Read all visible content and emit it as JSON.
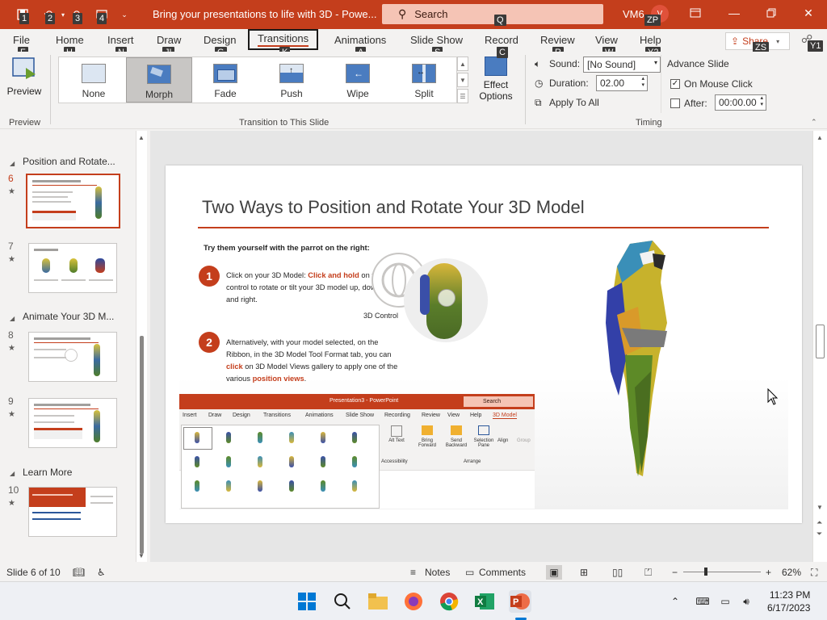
{
  "titlebar": {
    "doc_title": "Bring your presentations to life with 3D  -  Powe...",
    "search_label": "Search",
    "user_initials": "VM6",
    "avatar_text": "V",
    "keytips": [
      "1",
      "2",
      "3",
      "4",
      "Q",
      "ZP"
    ]
  },
  "tabs": [
    {
      "label": "File",
      "keytip": "F"
    },
    {
      "label": "Home",
      "keytip": "H"
    },
    {
      "label": "Insert",
      "keytip": "N"
    },
    {
      "label": "Draw",
      "keytip": "JI"
    },
    {
      "label": "Design",
      "keytip": "G"
    },
    {
      "label": "Transitions",
      "keytip": "K"
    },
    {
      "label": "Animations",
      "keytip": "A"
    },
    {
      "label": "Slide Show",
      "keytip": "S"
    },
    {
      "label": "Record",
      "keytip": "C"
    },
    {
      "label": "Review",
      "keytip": "R"
    },
    {
      "label": "View",
      "keytip": "W"
    },
    {
      "label": "Help",
      "keytip": "Y2"
    }
  ],
  "share": {
    "label": "Share",
    "keytip": "ZS",
    "extra_keytip": "Y1"
  },
  "ribbon": {
    "preview_label": "Preview",
    "preview_group": "Preview",
    "transitions": [
      "None",
      "Morph",
      "Fade",
      "Push",
      "Wipe",
      "Split"
    ],
    "selected_transition": "Morph",
    "effect_options_line1": "Effect",
    "effect_options_line2": "Options",
    "transition_group": "Transition to This Slide",
    "sound_label": "Sound:",
    "sound_value": "[No Sound]",
    "duration_label": "Duration:",
    "duration_value": "02.00",
    "apply_all_label": "Apply To All",
    "advance_slide_label": "Advance Slide",
    "on_mouse_click_label": "On Mouse Click",
    "on_mouse_click_checked": true,
    "after_label": "After:",
    "after_value": "00:00.00",
    "after_checked": false,
    "timing_group": "Timing"
  },
  "thumbnails": {
    "sections": [
      {
        "title": "Position and Rotate..."
      },
      {
        "title": "Animate Your 3D M..."
      },
      {
        "title": "Learn More"
      }
    ],
    "slides": [
      {
        "number": "6",
        "current": true
      },
      {
        "number": "7",
        "current": false
      },
      {
        "number": "8",
        "current": false
      },
      {
        "number": "9",
        "current": false
      },
      {
        "number": "10",
        "current": false
      }
    ]
  },
  "slide": {
    "title": "Two Ways to Position and Rotate Your 3D Model",
    "subtitle": "Try them yourself with the parrot on the right:",
    "step1_number": "1",
    "step1_a": "Click on your 3D Model: ",
    "step1_hl": "Click and hold",
    "step1_b": " on the 3D control to rotate or tilt your 3D model up, down, left, and right.",
    "step2_number": "2",
    "step2_a": "Alternatively, with your model selected, on the Ribbon, in the 3D Model Tool Format tab, you can ",
    "step2_hl1": "click",
    "step2_b": " on 3D Model Views gallery to apply one of the various ",
    "step2_hl2": "position views",
    "step2_c": ".",
    "control_label": "3D Control",
    "mini": {
      "title": "Presentation3  -  PowerPoint",
      "search": "Search",
      "tabs": [
        "Insert",
        "Draw",
        "Design",
        "Transitions",
        "Animations",
        "Slide Show",
        "Recording",
        "Review",
        "View",
        "Help",
        "3D Model"
      ],
      "alt_text": "Alt Text",
      "accessibility": "Accessibility",
      "bring_forward": "Bring Forward",
      "send_backward": "Send Backward",
      "selection_pane": "Selection Pane",
      "align": "Align",
      "group": "Group",
      "arrange": "Arrange"
    }
  },
  "statusbar": {
    "slide_info": "Slide 6 of 10",
    "notes_label": "Notes",
    "comments_label": "Comments",
    "zoom": "62%"
  },
  "taskbar": {
    "time": "11:23 PM",
    "date": "6/17/2023"
  },
  "colors": {
    "accent": "#c43e1c",
    "titlebar": "#c43e1c"
  }
}
